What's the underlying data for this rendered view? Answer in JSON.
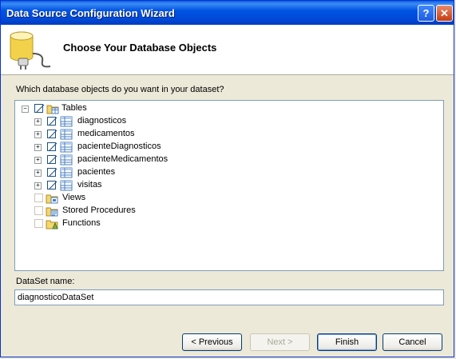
{
  "window": {
    "title": "Data Source Configuration Wizard",
    "help_button": "?",
    "close_button": "✕"
  },
  "header": {
    "title": "Choose Your Database Objects"
  },
  "prompt": "Which database objects do you want in your dataset?",
  "tree": {
    "tables": {
      "label": "Tables",
      "checked": "partial",
      "expanded": true,
      "children": [
        {
          "label": "diagnosticos",
          "checked": "partial"
        },
        {
          "label": "medicamentos",
          "checked": "partial"
        },
        {
          "label": "pacienteDiagnosticos",
          "checked": "partial"
        },
        {
          "label": "pacienteMedicamentos",
          "checked": "partial"
        },
        {
          "label": "pacientes",
          "checked": "partial"
        },
        {
          "label": "visitas",
          "checked": "partial"
        }
      ]
    },
    "views": {
      "label": "Views",
      "checked": "unchecked"
    },
    "stored_procedures": {
      "label": "Stored Procedures",
      "checked": "unchecked"
    },
    "functions": {
      "label": "Functions",
      "checked": "unchecked"
    }
  },
  "dataset": {
    "label": "DataSet name:",
    "value": "diagnosticoDataSet"
  },
  "buttons": {
    "previous": "< Previous",
    "next": "Next >",
    "finish": "Finish",
    "cancel": "Cancel"
  },
  "colors": {
    "titlebar": "#0054e3",
    "dialog_bg": "#ece9d8",
    "table_icon_blue": "#4a7fc1"
  }
}
